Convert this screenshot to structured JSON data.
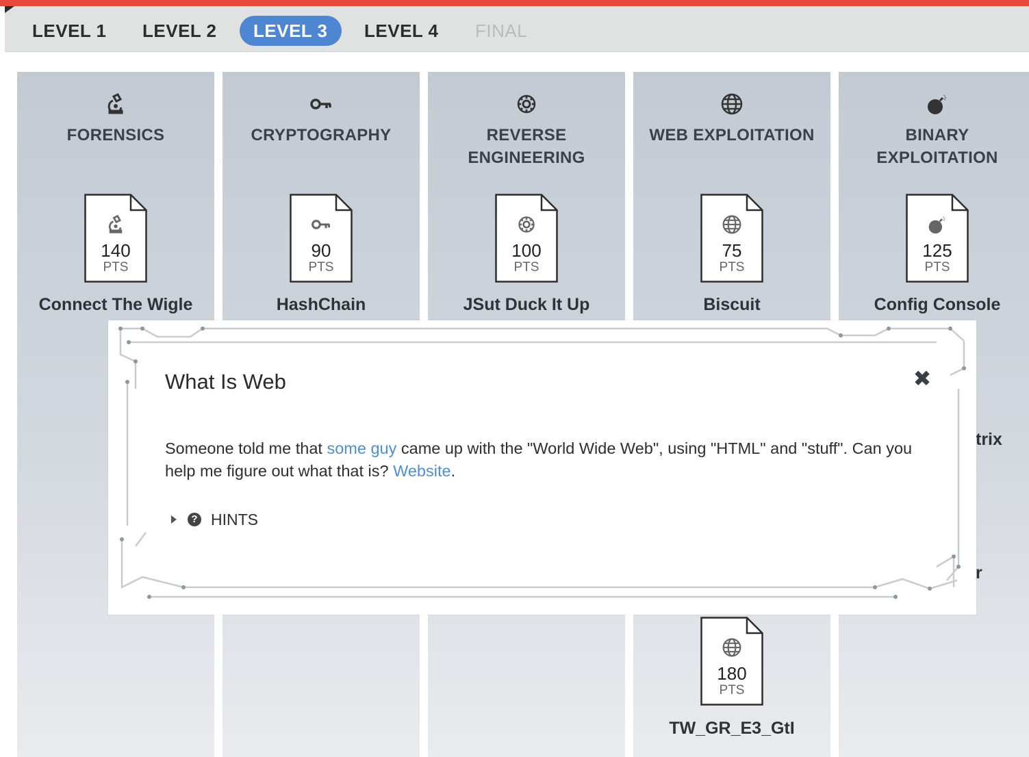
{
  "levels": [
    {
      "label": "LEVEL 1",
      "state": "normal"
    },
    {
      "label": "LEVEL 2",
      "state": "normal"
    },
    {
      "label": "LEVEL 3",
      "state": "active"
    },
    {
      "label": "LEVEL 4",
      "state": "normal"
    },
    {
      "label": "FINAL",
      "state": "disabled"
    }
  ],
  "categories": [
    {
      "title": "FORENSICS",
      "icon": "microscope-icon",
      "challenges": [
        {
          "points": "140",
          "unit": "PTS",
          "name": "Connect The Wigle"
        }
      ]
    },
    {
      "title": "CRYPTOGRAPHY",
      "icon": "key-icon",
      "challenges": [
        {
          "points": "90",
          "unit": "PTS",
          "name": "HashChain"
        }
      ]
    },
    {
      "title": "REVERSE ENGINEERING",
      "icon": "gear-icon",
      "challenges": [
        {
          "points": "100",
          "unit": "PTS",
          "name": "JSut Duck It Up"
        }
      ]
    },
    {
      "title": "WEB EXPLOITATION",
      "icon": "globe-icon",
      "challenges": [
        {
          "points": "75",
          "unit": "PTS",
          "name": "Biscuit"
        },
        {
          "points": "180",
          "unit": "PTS",
          "name": "TW_GR_E3_GtI"
        }
      ]
    },
    {
      "title": "BINARY EXPLOITATION",
      "icon": "bomb-icon",
      "challenges": [
        {
          "points": "125",
          "unit": "PTS",
          "name": "Config Console"
        }
      ]
    }
  ],
  "peek_text": {
    "a": "trix",
    "b": "r"
  },
  "modal": {
    "title": "What Is Web",
    "close_label": "✖",
    "body_before": "Someone told me that ",
    "link1": "some guy",
    "body_middle": " came up with the \"World Wide Web\", using \"HTML\" and \"stuff\". Can you help me figure out what that is? ",
    "link2": "Website",
    "body_after": ".",
    "hints_label": "HINTS",
    "hints_icon": "question-circle-icon"
  },
  "colors": {
    "accent": "#e8493a",
    "active_tab": "#4f86d1",
    "link": "#4f8ecf",
    "circuit": "#c6ccd0"
  }
}
